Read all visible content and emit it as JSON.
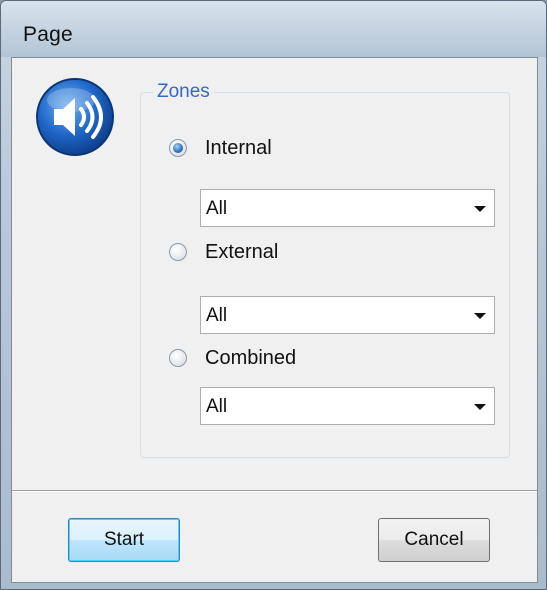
{
  "window": {
    "title": "Page"
  },
  "icon": {
    "name": "speaker-icon"
  },
  "zones": {
    "legend": "Zones",
    "options": [
      {
        "label": "Internal",
        "checked": true,
        "dropdown_value": "All"
      },
      {
        "label": "External",
        "checked": false,
        "dropdown_value": "All"
      },
      {
        "label": "Combined",
        "checked": false,
        "dropdown_value": "All"
      }
    ]
  },
  "buttons": {
    "start_label": "Start",
    "cancel_label": "Cancel"
  },
  "colors": {
    "legend_text": "#3368c8",
    "default_button_border": "#3c7fb1",
    "icon_blue": "#1f66c7"
  }
}
